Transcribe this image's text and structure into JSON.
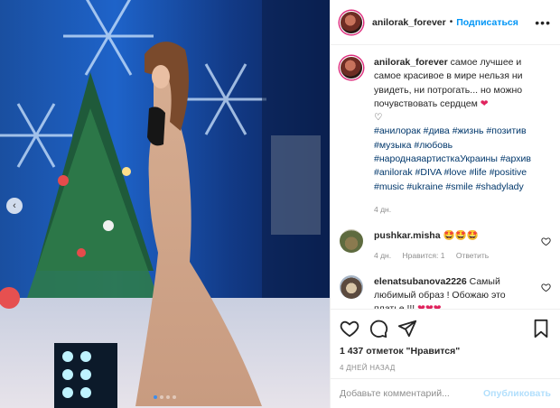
{
  "header": {
    "username": "anilorak_forever",
    "separator": "•",
    "follow_label": "Подписаться",
    "more_icon": "more-icon"
  },
  "caption": {
    "username": "anilorak_forever",
    "text": "самое лучшее и самое красивое в мире нельзя ни увидеть, ни потрогать... но можно почувствовать сердцем",
    "emoji_heart": "❤",
    "line2": "♡",
    "hashtags": [
      "#анилорак",
      "#дива",
      "#жизнь",
      "#позитив",
      "#музыка",
      "#любовь",
      "#народнаяартисткаУкраины",
      "#архив",
      "#anilorak",
      "#DIVA",
      "#love",
      "#life",
      "#positive",
      "#music",
      "#ukraine",
      "#smile",
      "#shadylady"
    ],
    "time": "4 дн."
  },
  "comments": [
    {
      "username": "pushkar.misha",
      "text": "🤩🤩🤩",
      "time": "4 дн.",
      "likes": "Нравится: 1",
      "reply": "Ответить"
    },
    {
      "username": "elenatsubanova2226",
      "text": "Самый любимый образ ! Обожаю это платье !!!",
      "text_hearts": "❤❤❤"
    }
  ],
  "actions": {
    "likes_text": "1 437 отметок \"Нравится\"",
    "date": "4 ДНЕЙ НАЗАД"
  },
  "add_comment": {
    "placeholder": "Добавьте комментарий...",
    "post_label": "Опубликовать"
  },
  "carousel": {
    "prev_icon": "chevron-left-icon",
    "dots": 4,
    "active_dot": 0
  },
  "colors": {
    "link": "#0095f6",
    "hashtag": "#00376b",
    "muted": "#8e8e8e",
    "heart": "#e0245e"
  }
}
